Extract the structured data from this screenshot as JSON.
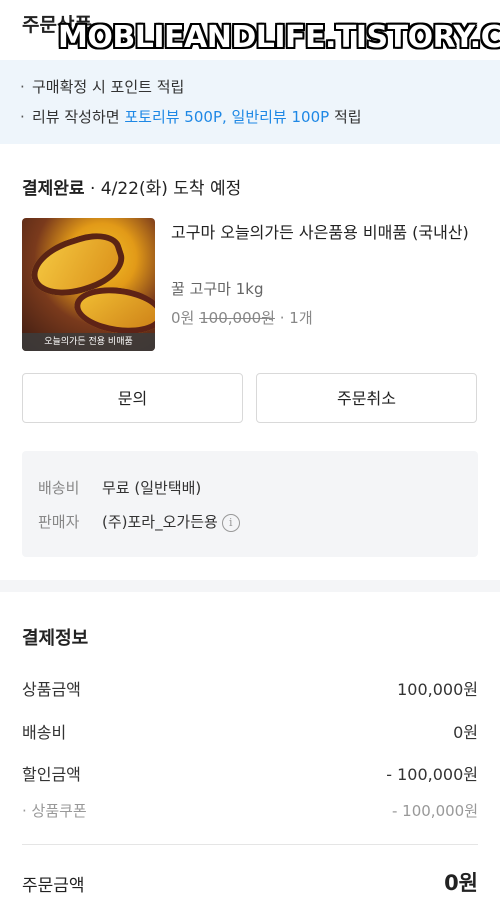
{
  "header": {
    "section_title": "주문상품",
    "watermark": "MOBLIEANDLIFE.TISTORY.COM"
  },
  "notice": {
    "line1": "구매확정 시 포인트 적립",
    "line2_prefix": "리뷰 작성하면 ",
    "line2_highlight": "포토리뷰 500P, 일반리뷰 100P",
    "line2_suffix": " 적립",
    "bullet": "·"
  },
  "order": {
    "status": "결제완료",
    "status_detail": " · 4/22(화) 도착 예정",
    "product": {
      "thumb_caption": "오늘의가든 전용 비매품",
      "name": "고구마 오늘의가든 사은품용 비매품 (국내산)",
      "option": "꿀 고구마 1kg",
      "price": "0원",
      "original_price": "100,000원",
      "quantity": " · 1개"
    },
    "buttons": {
      "inquiry": "문의",
      "cancel": "주문취소"
    },
    "delivery": {
      "fee_label": "배송비",
      "fee_value": "무료 (일반택배)",
      "seller_label": "판매자",
      "seller_value": "(주)포라_오가든용",
      "info_icon": "info-circle-icon",
      "info_glyph": "i"
    }
  },
  "payment": {
    "title": "결제정보",
    "rows": [
      {
        "label": "상품금액",
        "value": "100,000원"
      },
      {
        "label": "배송비",
        "value": "0원"
      },
      {
        "label": "할인금액",
        "value": "- 100,000원"
      }
    ],
    "sub_row": {
      "label": "· 상품쿠폰",
      "value": "- 100,000원"
    },
    "total": {
      "label": "주문금액",
      "value": "0원"
    }
  },
  "colors": {
    "accent": "#1e88e5",
    "notice_bg": "#eef5fb",
    "box_bg": "#f4f5f7"
  }
}
